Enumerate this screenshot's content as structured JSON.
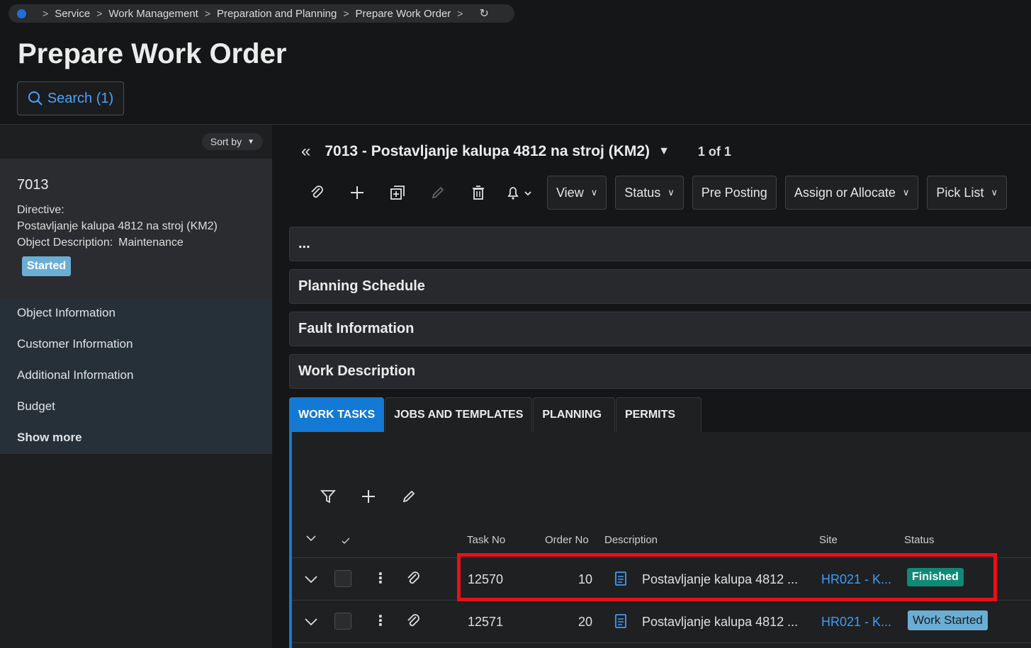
{
  "breadcrumb": {
    "items": [
      "Service",
      "Work Management",
      "Preparation and Planning",
      "Prepare Work Order"
    ]
  },
  "page": {
    "title": "Prepare Work Order",
    "search_label": "Search (1)"
  },
  "left_panel": {
    "sort_label": "Sort by",
    "card": {
      "id": "7013",
      "directive_label": "Directive:",
      "directive_value": "Postavljanje kalupa 4812 na stroj (KM2)",
      "object_desc_label": "Object Description:",
      "object_desc_value": "Maintenance",
      "status": "Started"
    },
    "nav_items": [
      "Object Information",
      "Customer Information",
      "Additional Information",
      "Budget"
    ],
    "show_more": "Show more"
  },
  "record": {
    "title": "7013 - Postavljanje kalupa 4812 na stroj (KM2)",
    "count": "1 of 1"
  },
  "toolbar": {
    "view": "View",
    "status": "Status",
    "pre_posting": "Pre Posting",
    "assign": "Assign or Allocate",
    "pick_list": "Pick List"
  },
  "sections": {
    "more": "...",
    "planning": "Planning Schedule",
    "fault": "Fault Information",
    "work_desc": "Work Description"
  },
  "tabs": [
    "WORK TASKS",
    "JOBS AND TEMPLATES",
    "PLANNING",
    "PERMITS"
  ],
  "table": {
    "headers": {
      "task_no": "Task No",
      "order_no": "Order No",
      "description": "Description",
      "site": "Site",
      "status": "Status"
    },
    "rows": [
      {
        "task_no": "12570",
        "order_no": "10",
        "description": "Postavljanje kalupa 4812 ...",
        "site": "HR021 - K...",
        "status": "Finished"
      },
      {
        "task_no": "12571",
        "order_no": "20",
        "description": "Postavljanje kalupa 4812 ...",
        "site": "HR021 - K...",
        "status": "Work Started"
      }
    ]
  },
  "colors": {
    "accent": "#1479d4",
    "link": "#3f9cf5",
    "finished": "#0f8a76",
    "started": "#6aaed6",
    "highlight": "#e8101a"
  }
}
